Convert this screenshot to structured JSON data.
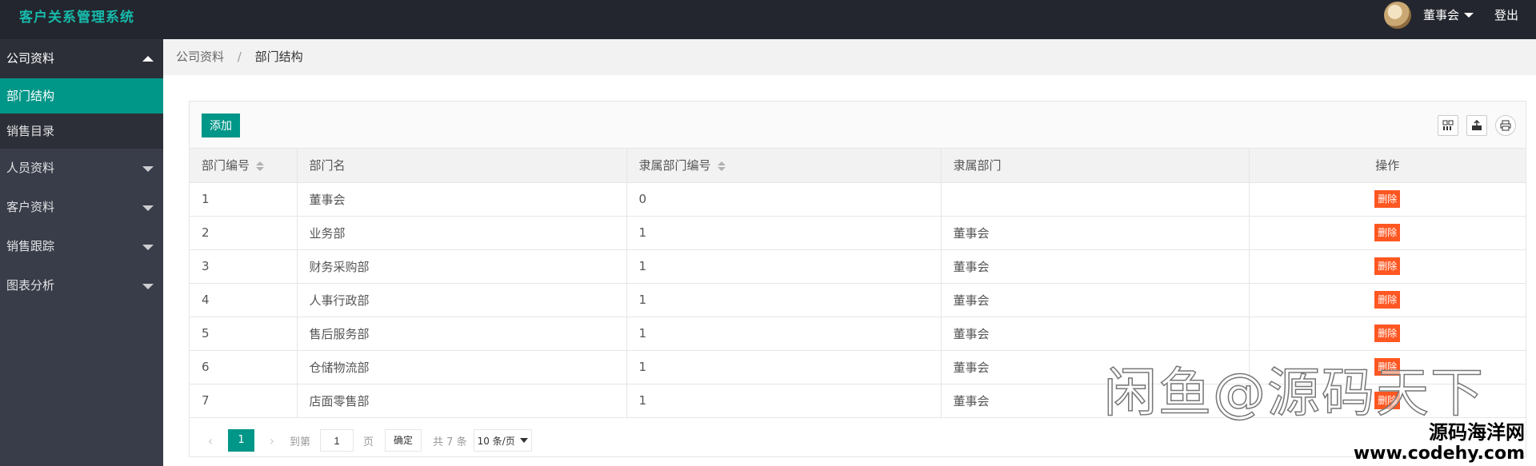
{
  "app": {
    "title": "客户关系管理系统"
  },
  "user": {
    "name": "董事会",
    "logout": "登出"
  },
  "sidebar": {
    "groups": [
      {
        "label": "公司资料",
        "open": true,
        "children": [
          {
            "label": "部门结构",
            "active": true
          },
          {
            "label": "销售目录",
            "active": false
          }
        ]
      },
      {
        "label": "人员资料",
        "open": false
      },
      {
        "label": "客户资料",
        "open": false
      },
      {
        "label": "销售跟踪",
        "open": false
      },
      {
        "label": "图表分析",
        "open": false
      }
    ]
  },
  "breadcrumb": {
    "parent": "公司资料",
    "separator": "/",
    "current": "部门结构"
  },
  "toolbar": {
    "add_label": "添加"
  },
  "table": {
    "columns": [
      "部门编号",
      "部门名",
      "隶属部门编号",
      "隶属部门",
      "操作"
    ],
    "rows": [
      {
        "id": "1",
        "name": "董事会",
        "parent_id": "0",
        "parent": "",
        "action": "删除"
      },
      {
        "id": "2",
        "name": "业务部",
        "parent_id": "1",
        "parent": "董事会",
        "action": "删除"
      },
      {
        "id": "3",
        "name": "财务采购部",
        "parent_id": "1",
        "parent": "董事会",
        "action": "删除"
      },
      {
        "id": "4",
        "name": "人事行政部",
        "parent_id": "1",
        "parent": "董事会",
        "action": "删除"
      },
      {
        "id": "5",
        "name": "售后服务部",
        "parent_id": "1",
        "parent": "董事会",
        "action": "删除"
      },
      {
        "id": "6",
        "name": "仓储物流部",
        "parent_id": "1",
        "parent": "董事会",
        "action": "删除"
      },
      {
        "id": "7",
        "name": "店面零售部",
        "parent_id": "1",
        "parent": "董事会",
        "action": "删除"
      }
    ]
  },
  "pager": {
    "current": "1",
    "goto_label": "到第",
    "goto_value": "1",
    "page_unit": "页",
    "confirm": "确定",
    "total": "共 7 条",
    "page_size": "10 条/页"
  },
  "watermark": {
    "main": "闲鱼@源码天下",
    "site_cn": "源码海洋网",
    "site_url": "www.codehy.com"
  },
  "colors": {
    "accent": "#009688",
    "danger": "#ff5722",
    "header": "#23262e",
    "sidebar": "#393d49"
  }
}
